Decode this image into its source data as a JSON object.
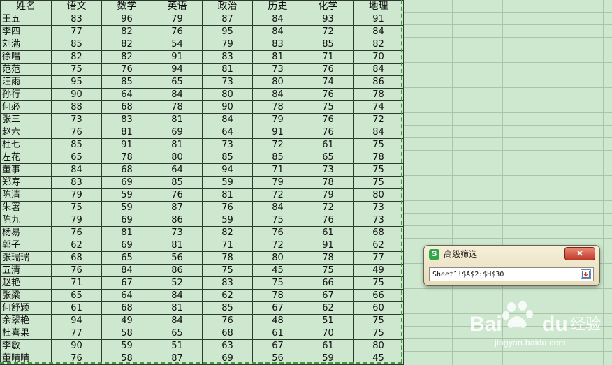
{
  "table": {
    "headers": [
      "姓名",
      "语文",
      "数学",
      "英语",
      "政治",
      "历史",
      "化学",
      "地理"
    ],
    "rows": [
      [
        "王五",
        "83",
        "96",
        "79",
        "87",
        "84",
        "93",
        "91"
      ],
      [
        "李四",
        "77",
        "82",
        "76",
        "95",
        "84",
        "72",
        "84"
      ],
      [
        "刘满",
        "85",
        "82",
        "54",
        "79",
        "83",
        "85",
        "82"
      ],
      [
        "徐唱",
        "82",
        "82",
        "91",
        "83",
        "81",
        "71",
        "70"
      ],
      [
        "范范",
        "75",
        "76",
        "94",
        "81",
        "73",
        "76",
        "84"
      ],
      [
        "汪雨",
        "95",
        "85",
        "65",
        "73",
        "80",
        "74",
        "86"
      ],
      [
        "孙行",
        "90",
        "64",
        "84",
        "80",
        "84",
        "76",
        "78"
      ],
      [
        "何必",
        "88",
        "68",
        "78",
        "90",
        "78",
        "75",
        "74"
      ],
      [
        "张三",
        "73",
        "83",
        "81",
        "84",
        "79",
        "76",
        "72"
      ],
      [
        "赵六",
        "76",
        "81",
        "69",
        "64",
        "91",
        "76",
        "84"
      ],
      [
        "杜七",
        "85",
        "91",
        "81",
        "73",
        "72",
        "61",
        "75"
      ],
      [
        "左花",
        "65",
        "78",
        "80",
        "85",
        "85",
        "65",
        "78"
      ],
      [
        "董事",
        "84",
        "68",
        "64",
        "94",
        "71",
        "73",
        "75"
      ],
      [
        "郑寿",
        "83",
        "69",
        "85",
        "59",
        "79",
        "78",
        "75"
      ],
      [
        "陈清",
        "79",
        "59",
        "76",
        "81",
        "72",
        "79",
        "80"
      ],
      [
        "朱署",
        "75",
        "59",
        "87",
        "76",
        "84",
        "72",
        "73"
      ],
      [
        "陈九",
        "79",
        "69",
        "86",
        "59",
        "75",
        "76",
        "73"
      ],
      [
        "杨易",
        "76",
        "81",
        "73",
        "82",
        "76",
        "61",
        "68"
      ],
      [
        "郭子",
        "62",
        "69",
        "81",
        "71",
        "72",
        "91",
        "62"
      ],
      [
        "张瑞瑞",
        "68",
        "65",
        "56",
        "78",
        "80",
        "78",
        "77"
      ],
      [
        "五清",
        "76",
        "84",
        "86",
        "75",
        "45",
        "75",
        "49"
      ],
      [
        "赵艳",
        "71",
        "67",
        "52",
        "83",
        "75",
        "66",
        "75"
      ],
      [
        "张梁",
        "65",
        "64",
        "84",
        "62",
        "78",
        "67",
        "66"
      ],
      [
        "何舒颖",
        "61",
        "68",
        "81",
        "85",
        "67",
        "62",
        "60"
      ],
      [
        "余翠艳",
        "94",
        "49",
        "84",
        "76",
        "48",
        "51",
        "75"
      ],
      [
        "杜喜果",
        "77",
        "58",
        "65",
        "68",
        "61",
        "70",
        "75"
      ],
      [
        "李敏",
        "90",
        "59",
        "51",
        "63",
        "67",
        "61",
        "80"
      ],
      [
        "董晴晴",
        "76",
        "58",
        "87",
        "69",
        "56",
        "59",
        "45"
      ]
    ]
  },
  "dialog": {
    "title": "高级筛选",
    "app_icon_letter": "S",
    "close_label": "✕",
    "range_value": "Sheet1!$A$2:$H$30"
  },
  "watermark": {
    "brand_text": "Baidu经验",
    "site": "jingyan.baidu.com"
  },
  "colors": {
    "sheet_background": "#cde8cf",
    "gridline": "#a9c4ab",
    "selection_marquee": "#3f9b3c",
    "app_icon": "#2fa84a",
    "close_button": "#c0392b"
  }
}
